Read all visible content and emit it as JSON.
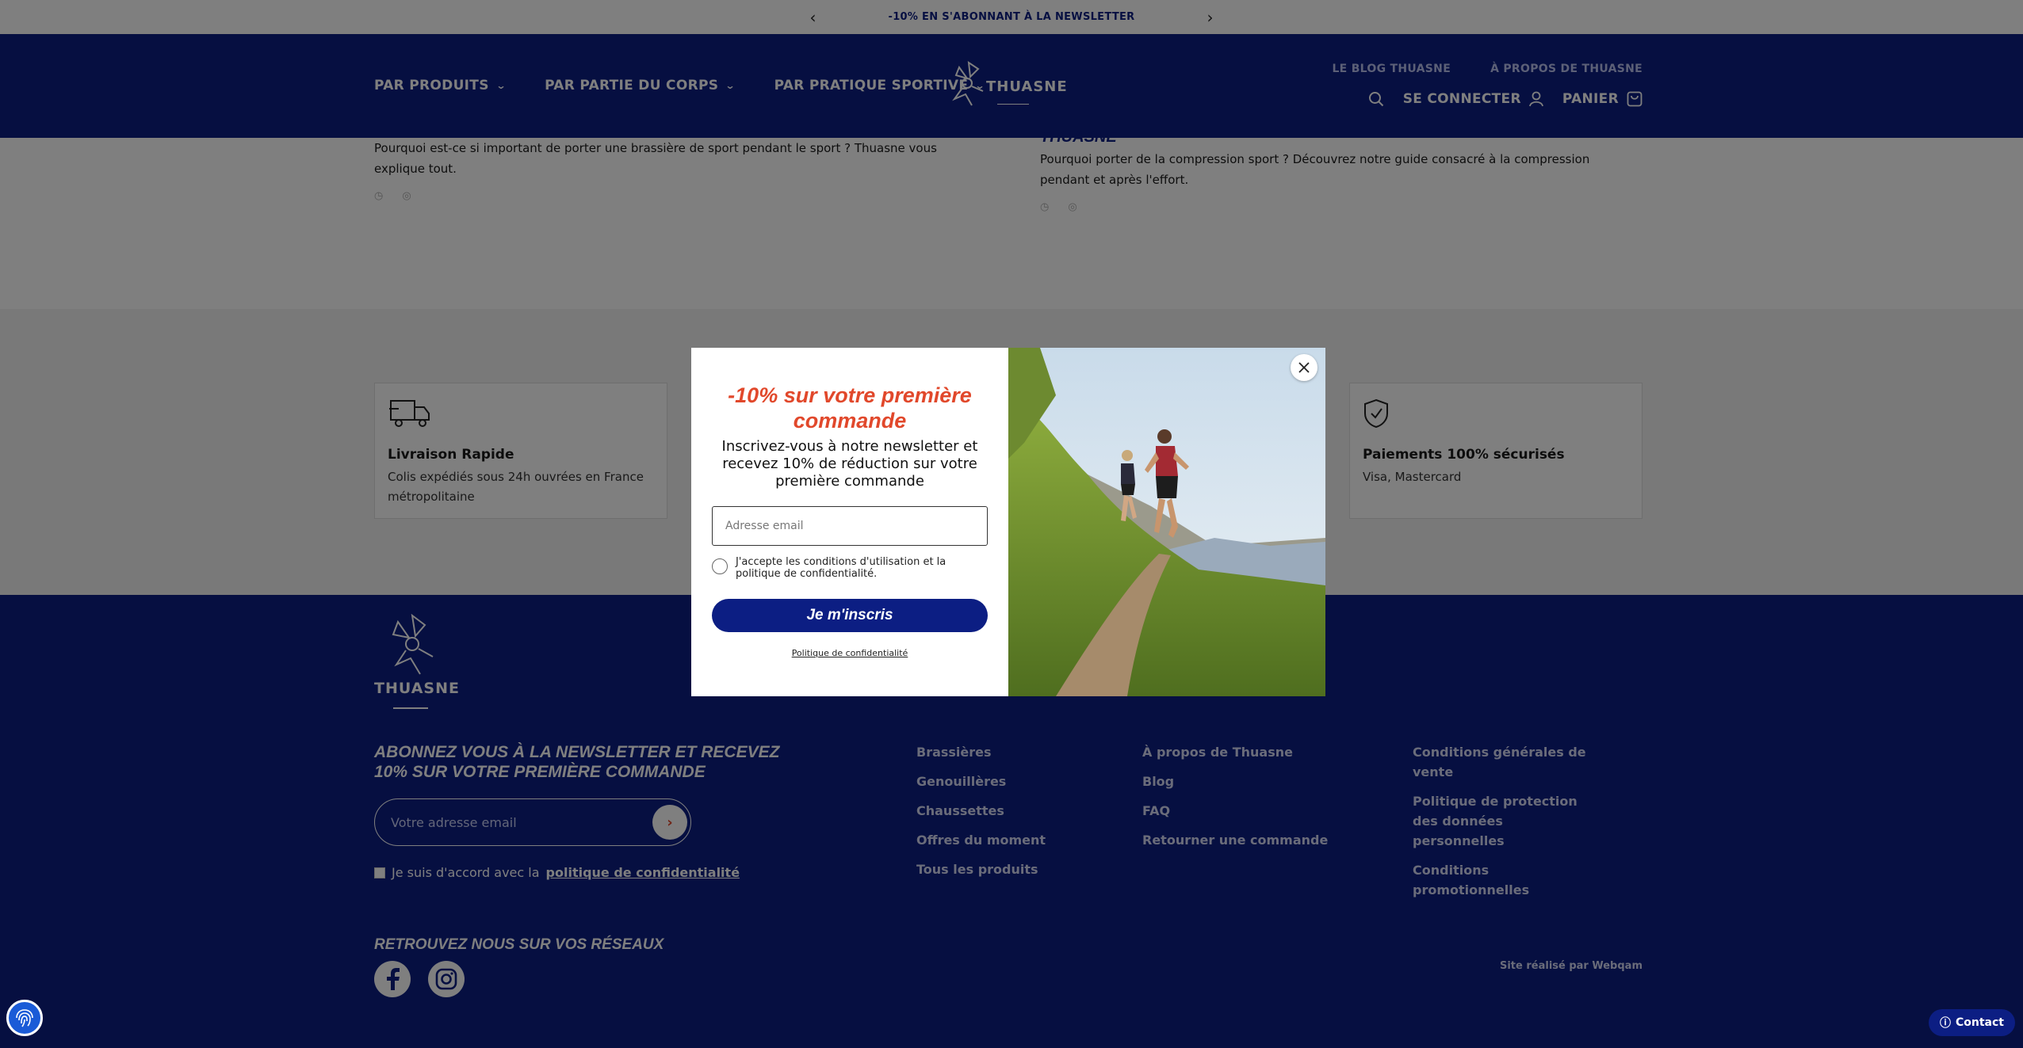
{
  "announcement": {
    "text": "-10% EN S'ABONNANT À LA NEWSLETTER",
    "prev": "‹",
    "next": "›"
  },
  "header": {
    "nav": [
      {
        "label": "PAR PRODUITS"
      },
      {
        "label": "PAR PARTIE DU CORPS"
      },
      {
        "label": "PAR PRATIQUE SPORTIVE"
      }
    ],
    "logo_text": "THUASNE",
    "top_links": [
      "LE BLOG THUASNE",
      "À PROPOS DE THUASNE"
    ],
    "login_label": "SE CONNECTER",
    "cart_label": "PANIER"
  },
  "blog": {
    "left": {
      "text": "Pourquoi est-ce si important de porter une brassière de sport pendant le sport ? Thuasne vous explique tout."
    },
    "right": {
      "title_fragment": "THUASNE",
      "text": "Pourquoi porter de la compression sport ?  Découvrez notre guide consacré à la compression pendant et après l'effort."
    }
  },
  "reassurance": [
    {
      "title": "Livraison Rapide",
      "desc": "Colis expédiés sous 24h ouvrées en France métropolitaine",
      "icon": "truck-icon"
    },
    {
      "title": "Paiements 100% sécurisés",
      "desc": "Visa, Mastercard",
      "icon": "shield-icon"
    }
  ],
  "footer": {
    "logo_text": "THUASNE",
    "newsletter_title": "Abonnez vous à la newsletter et recevez 10% sur votre première commande",
    "email_placeholder": "Votre adresse email",
    "consent_prefix": "Je suis d'accord avec la",
    "consent_link": "politique de confidentialité",
    "col1": [
      "Brassières",
      "Genouillères",
      "Chaussettes",
      "Offres du moment",
      "Tous les produits"
    ],
    "col2": [
      "À propos de Thuasne",
      "Blog",
      "FAQ",
      "Retourner une commande"
    ],
    "col3": [
      "Conditions générales de vente",
      "Politique de protection des données personnelles",
      "Conditions promotionnelles"
    ],
    "social_title": "Retrouvez nous sur vos réseaux",
    "credit": "Site réalisé par Webqam"
  },
  "modal": {
    "title": "-10% sur votre première commande",
    "subtitle": "Inscrivez-vous à notre newsletter et recevez 10% de réduction sur votre première commande",
    "email_placeholder": "Adresse email",
    "consent": "J'accepte les conditions d'utilisation et la politique de confidentialité.",
    "button": "Je m'inscris",
    "policy": "Politique de confidentialité"
  },
  "widgets": {
    "contact": "Contact"
  },
  "colors": {
    "brand": "#0c1e83",
    "accent": "#e1482b"
  }
}
